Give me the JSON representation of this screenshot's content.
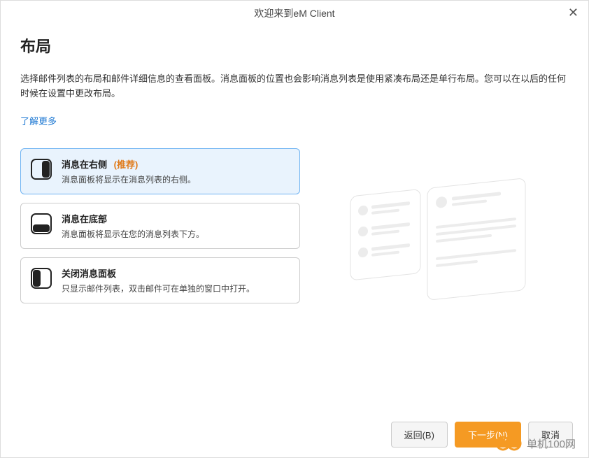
{
  "titlebar": {
    "title": "欢迎来到eM Client",
    "close": "✕"
  },
  "page": {
    "heading": "布局",
    "description": "选择邮件列表的布局和邮件详细信息的查看面板。消息面板的位置也会影响消息列表是使用紧凑布局还是单行布局。您可以在以后的任何时候在设置中更改布局。",
    "learn_more": "了解更多"
  },
  "options": [
    {
      "title": "消息在右侧",
      "recommended": "(推荐)",
      "description": "消息面板将显示在消息列表的右侧。",
      "selected": true
    },
    {
      "title": "消息在底部",
      "recommended": "",
      "description": "消息面板将显示在您的消息列表下方。",
      "selected": false
    },
    {
      "title": "关闭消息面板",
      "recommended": "",
      "description": "只显示邮件列表，双击邮件可在单独的窗口中打开。",
      "selected": false
    }
  ],
  "footer": {
    "back": "返回(B)",
    "next": "下一步(N)",
    "cancel": "取消"
  },
  "watermark": {
    "text": "单机100网"
  }
}
